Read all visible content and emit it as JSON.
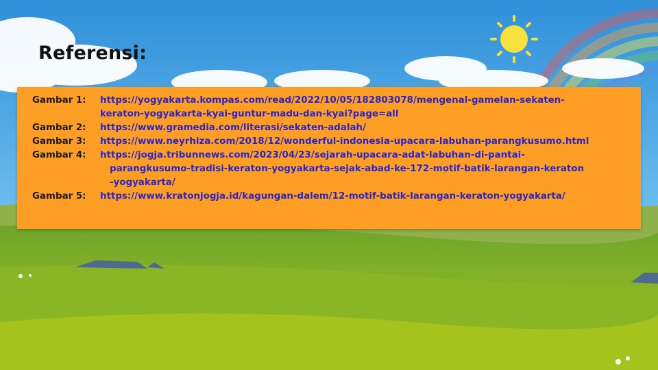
{
  "slide": {
    "title": "Referensi:"
  },
  "references": [
    {
      "label": "Gambar 1:",
      "lines": [
        "https://yogyakarta.kompas.com/read/2022/10/05/182803078/mengenal-gamelan-sekaten-",
        "keraton-yogyakarta-kyai-guntur-madu-dan-kyai?page=all"
      ]
    },
    {
      "label": "Gambar 2:",
      "lines": [
        "https://www.gramedia.com/literasi/sekaten-adalah/"
      ]
    },
    {
      "label": "Gambar 3:",
      "lines": [
        "https://www.neyrhiza.com/2018/12/wonderful-indonesia-upacara-labuhan-parangkusumo.html"
      ]
    },
    {
      "label": "Gambar 4:",
      "lines": [
        "https://jogja.tribunnews.com/2023/04/23/sejarah-upacara-adat-labuhan-di-pantai-",
        "parangkusumo-tradisi-keraton-yogyakarta-sejak-abad-ke-172-motif-batik-larangan-keraton",
        "-yogyakarta/"
      ]
    },
    {
      "label": "Gambar 5:",
      "lines": [
        "https://www.kratonjogja.id/kagungan-dalem/12-motif-batik-larangan-keraton-yogyakarta/"
      ]
    }
  ],
  "colors": {
    "panel": "#ff9e24",
    "link": "#2a25c6",
    "label": "#1b1b1b"
  }
}
